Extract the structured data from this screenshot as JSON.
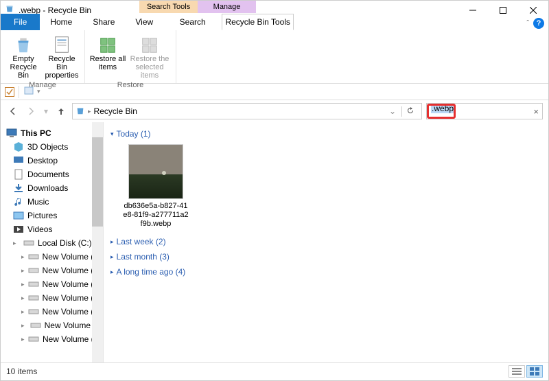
{
  "window": {
    "title": ".webp - Recycle Bin",
    "context_tabs": {
      "search": "Search Tools",
      "manage": "Manage"
    }
  },
  "menubar": {
    "file": "File",
    "home": "Home",
    "share": "Share",
    "view": "View",
    "search": "Search",
    "recycle_tools": "Recycle Bin Tools"
  },
  "ribbon": {
    "empty": "Empty Recycle Bin",
    "properties": "Recycle Bin properties",
    "restore_all": "Restore all items",
    "restore_sel": "Restore the selected items",
    "group_manage": "Manage",
    "group_restore": "Restore"
  },
  "address": {
    "location": "Recycle Bin"
  },
  "search": {
    "value": ".webp"
  },
  "sidebar": {
    "root": "This PC",
    "items": [
      "3D Objects",
      "Desktop",
      "Documents",
      "Downloads",
      "Music",
      "Pictures",
      "Videos",
      "Local Disk (C:)",
      "New Volume (D:)",
      "New Volume (E:)",
      "New Volume (F:)",
      "New Volume (G:)",
      "New Volume (H:)",
      "New Volume (I:)",
      "New Volume (J:)"
    ]
  },
  "content": {
    "groups": [
      {
        "label": "Today (1)",
        "expanded": true
      },
      {
        "label": "Last week (2)",
        "expanded": false
      },
      {
        "label": "Last month (3)",
        "expanded": false
      },
      {
        "label": "A long time ago (4)",
        "expanded": false
      }
    ],
    "file": {
      "name": "db636e5a-b827-41e8-81f9-a277711a2f9b.webp"
    }
  },
  "status": {
    "count": "10 items"
  }
}
